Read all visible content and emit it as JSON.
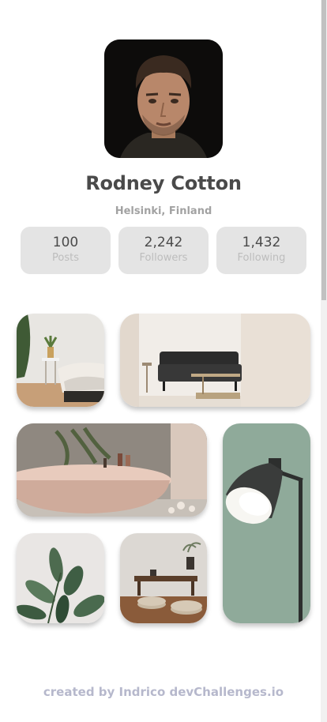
{
  "profile": {
    "name": "Rodney Cotton",
    "location": "Helsinki, Finland",
    "avatar_icon": "profile-photo"
  },
  "stats": [
    {
      "value": "100",
      "label": "Posts"
    },
    {
      "value": "2,242",
      "label": "Followers"
    },
    {
      "value": "1,432",
      "label": "Following"
    }
  ],
  "gallery": [
    {
      "name": "bedroom-photo"
    },
    {
      "name": "sofa-photo"
    },
    {
      "name": "bathtub-photo"
    },
    {
      "name": "lamp-photo"
    },
    {
      "name": "plant-photo"
    },
    {
      "name": "table-photo"
    }
  ],
  "footer": {
    "credit": "created by Indrico devChallenges.io"
  },
  "colors": {
    "name": "#4a4a4a",
    "stat_bg": "#e4e4e4",
    "footer": "#b6b8cc"
  }
}
